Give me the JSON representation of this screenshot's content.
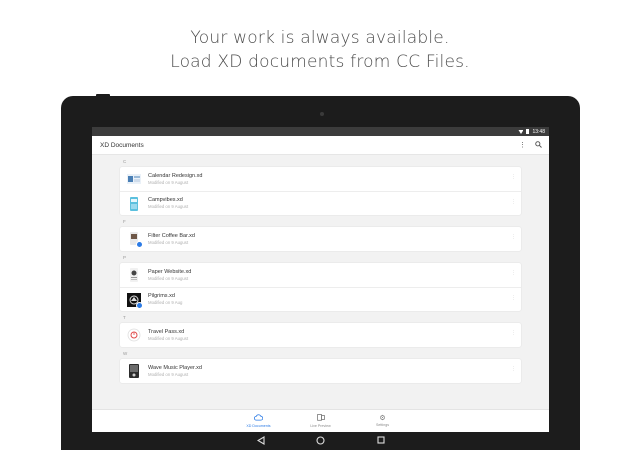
{
  "headline": {
    "line1": "Your work is always available.",
    "line2": "Load XD documents from CC Files."
  },
  "status_bar": {
    "time": "13:48"
  },
  "app_bar": {
    "title": "XD Documents",
    "icons": [
      "more-vert-icon",
      "search-icon"
    ]
  },
  "sections": [
    {
      "letter": "C",
      "files": [
        {
          "name": "Calendar Redesign.xd",
          "meta": "Modified on 9 August",
          "thumb": "calendar-thumb"
        },
        {
          "name": "Campvibes.xd",
          "meta": "Modified on 9 August",
          "thumb": "campvibes-thumb"
        }
      ]
    },
    {
      "letter": "F",
      "files": [
        {
          "name": "Filter Coffee Bar.xd",
          "meta": "Modified on 9 August",
          "thumb": "coffee-thumb"
        }
      ]
    },
    {
      "letter": "P",
      "files": [
        {
          "name": "Paper Website.xd",
          "meta": "Modified on 9 August",
          "thumb": "paper-thumb"
        },
        {
          "name": "Pilgrims.xd",
          "meta": "Modified on 9 Aug",
          "thumb": "pilgrims-thumb"
        }
      ]
    },
    {
      "letter": "T",
      "files": [
        {
          "name": "Travel Pass.xd",
          "meta": "Modified on 9 August",
          "thumb": "travel-thumb"
        }
      ]
    },
    {
      "letter": "W",
      "files": [
        {
          "name": "Wave Music Player.xd",
          "meta": "Modified on 9 August",
          "thumb": "wave-thumb"
        }
      ]
    }
  ],
  "row_menu_glyph": "⋮",
  "bottom_nav": [
    {
      "label": "XD Documents",
      "icon": "cloud-icon",
      "active": true
    },
    {
      "label": "Live Preview",
      "icon": "preview-icon",
      "active": false
    },
    {
      "label": "Settings",
      "icon": "gear-icon",
      "active": false
    }
  ],
  "colors": {
    "accent": "#2c7be5",
    "status_bar": "#3c3c3c",
    "device": "#1c1c1c"
  }
}
